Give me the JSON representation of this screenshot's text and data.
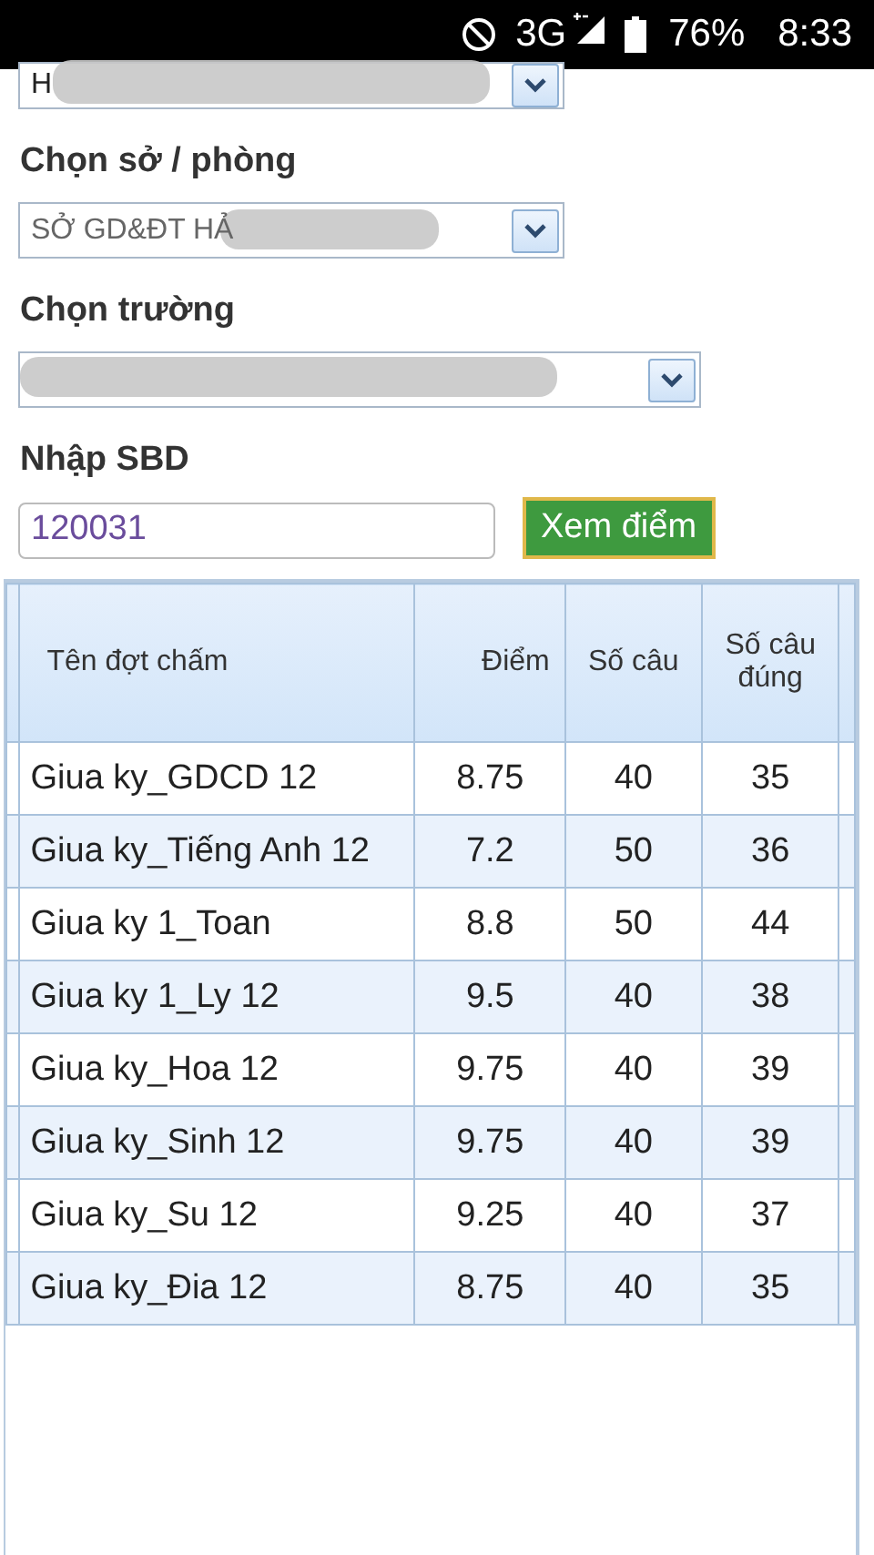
{
  "status_bar": {
    "network": "3G",
    "battery": "76%",
    "time": "8:33"
  },
  "selects": [
    {
      "value": "H",
      "redacted": true
    },
    {
      "label": "Chọn sở / phòng",
      "value": "SỞ GD&ĐT HẢ",
      "redacted": true
    },
    {
      "label": "Chọn trường",
      "redacted": true
    }
  ],
  "sbd": {
    "label": "Nhập SBD",
    "value": "120031"
  },
  "submit_button": "Xem điểm",
  "table": {
    "columns": [
      "Tên đợt chấm",
      "Điểm",
      "Số câu",
      "Số câu đúng"
    ],
    "rows": [
      [
        "Giua ky_GDCD 12",
        "8.75",
        "40",
        "35"
      ],
      [
        "Giua ky_Tiếng Anh 12",
        "7.2",
        "50",
        "36"
      ],
      [
        "Giua ky 1_Toan",
        "8.8",
        "50",
        "44"
      ],
      [
        "Giua ky 1_Ly 12",
        "9.5",
        "40",
        "38"
      ],
      [
        "Giua ky_Hoa 12",
        "9.75",
        "40",
        "39"
      ],
      [
        "Giua ky_Sinh 12",
        "9.75",
        "40",
        "39"
      ],
      [
        "Giua ky_Su 12",
        "9.25",
        "40",
        "37"
      ],
      [
        "Giua ky_Đia 12",
        "8.75",
        "40",
        "35"
      ]
    ]
  }
}
